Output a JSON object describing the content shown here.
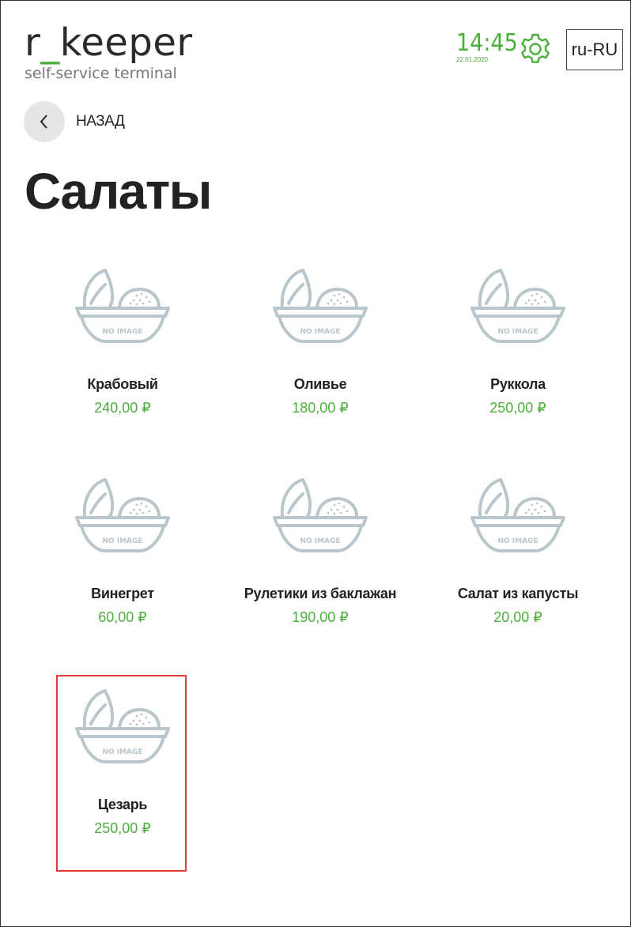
{
  "header": {
    "logo_prefix": "r",
    "logo_underscore": "_",
    "logo_suffix": "keeper",
    "logo_subtitle": "self-service terminal",
    "time": "14:45",
    "date": "22.01.2020",
    "language": "ru-RU",
    "accent_color": "#4caf3c"
  },
  "nav": {
    "back_label": "НАЗАД"
  },
  "page": {
    "title": "Салаты"
  },
  "products": [
    {
      "name": "Крабовый",
      "price": "240,00 ₽",
      "image_label": "NO IMAGE"
    },
    {
      "name": "Оливье",
      "price": "180,00 ₽",
      "image_label": "NO IMAGE"
    },
    {
      "name": "Руккола",
      "price": "250,00 ₽",
      "image_label": "NO IMAGE"
    },
    {
      "name": "Винегрет",
      "price": "60,00 ₽",
      "image_label": "NO IMAGE"
    },
    {
      "name": "Рулетики из баклажан",
      "price": "190,00 ₽",
      "image_label": "NO IMAGE"
    },
    {
      "name": "Салат из капусты",
      "price": "20,00 ₽",
      "image_label": "NO IMAGE"
    },
    {
      "name": "Цезарь",
      "price": "250,00 ₽",
      "image_label": "NO IMAGE",
      "selected": true
    }
  ]
}
